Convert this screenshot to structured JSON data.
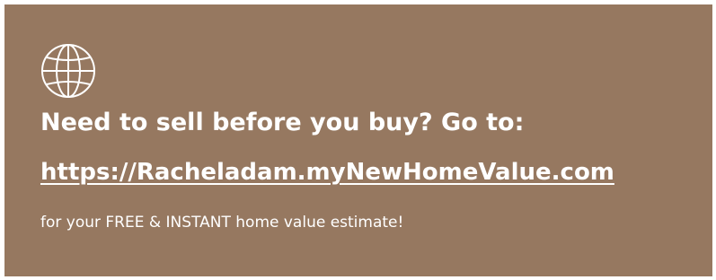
{
  "banner": {
    "background_color": "#967860",
    "text_color": "#ffffff",
    "icon": "globe-icon",
    "headline": "Need to sell before you buy? Go to:",
    "link_text": "https://Racheladam.myNewHomeValue.com",
    "subtext": "for your FREE & INSTANT home value estimate!"
  }
}
